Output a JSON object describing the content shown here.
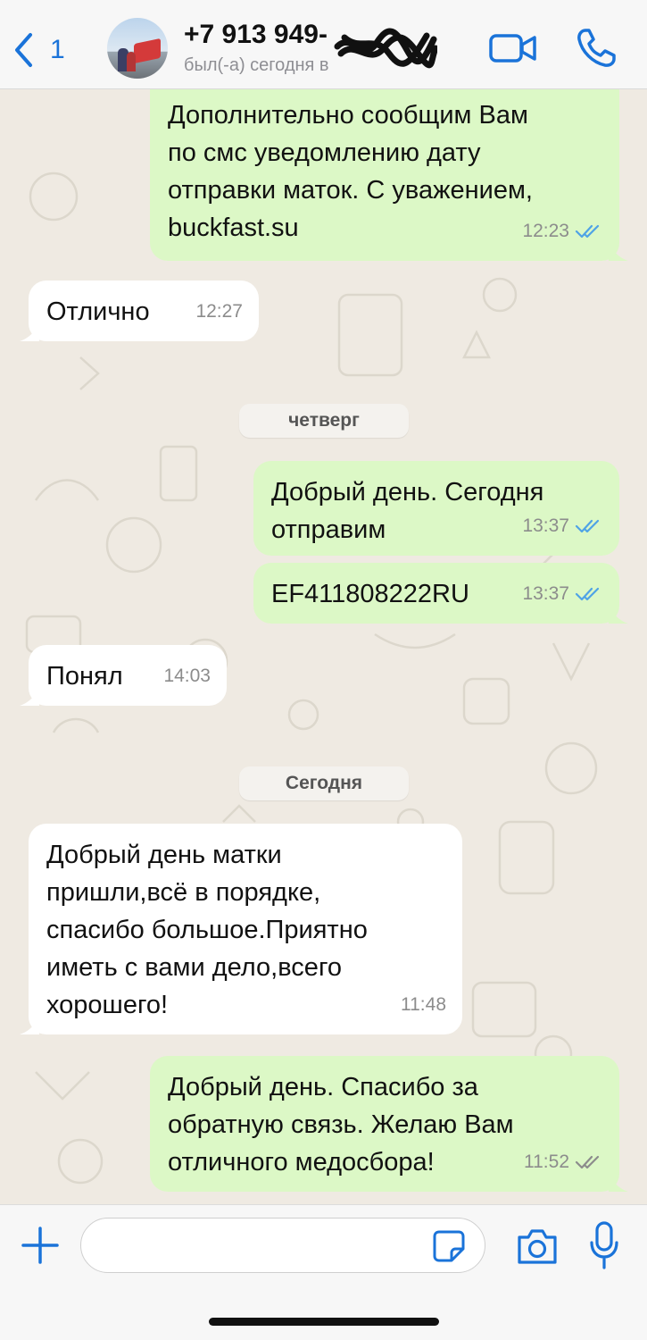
{
  "header": {
    "back_count": "1",
    "contact_name": "+7 913 949-",
    "contact_status": "был(-а) сегодня в",
    "back_icon": "chevron-left-icon",
    "video_icon": "video-camera-icon",
    "call_icon": "phone-icon",
    "accent_color": "#1a73d9"
  },
  "chat": {
    "messages": [
      {
        "direction": "out",
        "text": "Дополнительно сообщим Вам\nпо смс уведомлению дату\nотправки маток. С уважением,\nbuckfast.su",
        "time": "12:23",
        "status": "read"
      },
      {
        "direction": "in",
        "text": "Отлично",
        "time": "12:27"
      },
      {
        "direction": "out",
        "text": "Добрый день. Сегодня\nотправим",
        "time": "13:37",
        "status": "read"
      },
      {
        "direction": "out",
        "text": "EF411808222RU",
        "time": "13:37",
        "status": "read"
      },
      {
        "direction": "in",
        "text": "Понял",
        "time": "14:03"
      },
      {
        "direction": "in",
        "text": "Добрый день матки\nпришли,всё в порядке,\nспасибо большое.Приятно\nиметь с вами дело,всего\nхорошего!",
        "time": "11:48"
      },
      {
        "direction": "out",
        "text": "Добрый день. Спасибо за\nобратную связь. Желаю Вам\nотличного медосбора!",
        "time": "11:52",
        "status": "delivered"
      }
    ],
    "date_separators": [
      "четверг",
      "Сегодня"
    ],
    "colors": {
      "outgoing_bubble": "#dcf8c6",
      "incoming_bubble": "#ffffff",
      "read_check": "#4fa3e6",
      "delivered_check": "#8c8c8c",
      "wallpaper": "#efeae2"
    }
  },
  "input_bar": {
    "message_value": "",
    "plus_icon": "plus-icon",
    "sticker_icon": "sticker-icon",
    "camera_icon": "camera-icon",
    "mic_icon": "microphone-icon"
  }
}
